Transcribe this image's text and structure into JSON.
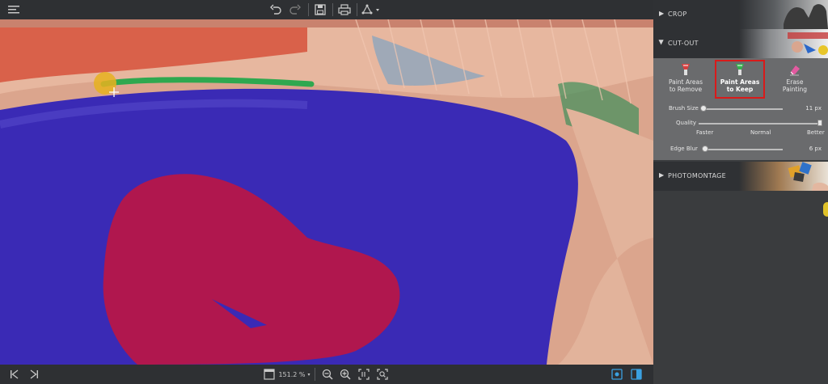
{
  "toolbar": {
    "icons": [
      "menu-icon",
      "undo-icon",
      "redo-icon",
      "save-icon",
      "print-icon",
      "share-icon"
    ]
  },
  "bottombar": {
    "zoom": "151.2 %",
    "icons": [
      "first-icon",
      "next-icon",
      "zoom-fit-icon",
      "zoom-out-icon",
      "zoom-in-icon",
      "actual-size-icon",
      "fit-screen-icon",
      "view-single-icon",
      "view-split-icon"
    ]
  },
  "panel": {
    "sections": [
      {
        "id": "crop",
        "label": "CROP",
        "expanded": false
      },
      {
        "id": "cut-out",
        "label": "CUT-OUT",
        "expanded": true
      },
      {
        "id": "photomontage",
        "label": "PHOTOMONTAGE",
        "expanded": false
      }
    ],
    "tools": [
      {
        "id": "remove",
        "label_line1": "Paint Areas",
        "label_line2": "to Remove",
        "active": false
      },
      {
        "id": "keep",
        "label_line1": "Paint Areas",
        "label_line2": "to Keep",
        "active": true
      },
      {
        "id": "erase",
        "label_line1": "Erase",
        "label_line2": "Painting",
        "active": false
      }
    ],
    "brush_size": {
      "label": "Brush Size",
      "value": "11 px",
      "fraction": 0.0
    },
    "quality": {
      "label": "Quality",
      "marks": [
        "Faster",
        "Normal",
        "Better"
      ],
      "fraction": 1.0
    },
    "edge_blur": {
      "label": "Edge Blur",
      "value": "6 px",
      "fraction": 0.02
    }
  },
  "colors": {
    "keep_stroke": "#2fa84f",
    "remove_fill": "#b0174e",
    "lens_fill": "#3a2ab5",
    "active_border": "#d91a1a",
    "panel_bg": "#3a3c3e",
    "toolbar_bg": "#2e3033"
  }
}
